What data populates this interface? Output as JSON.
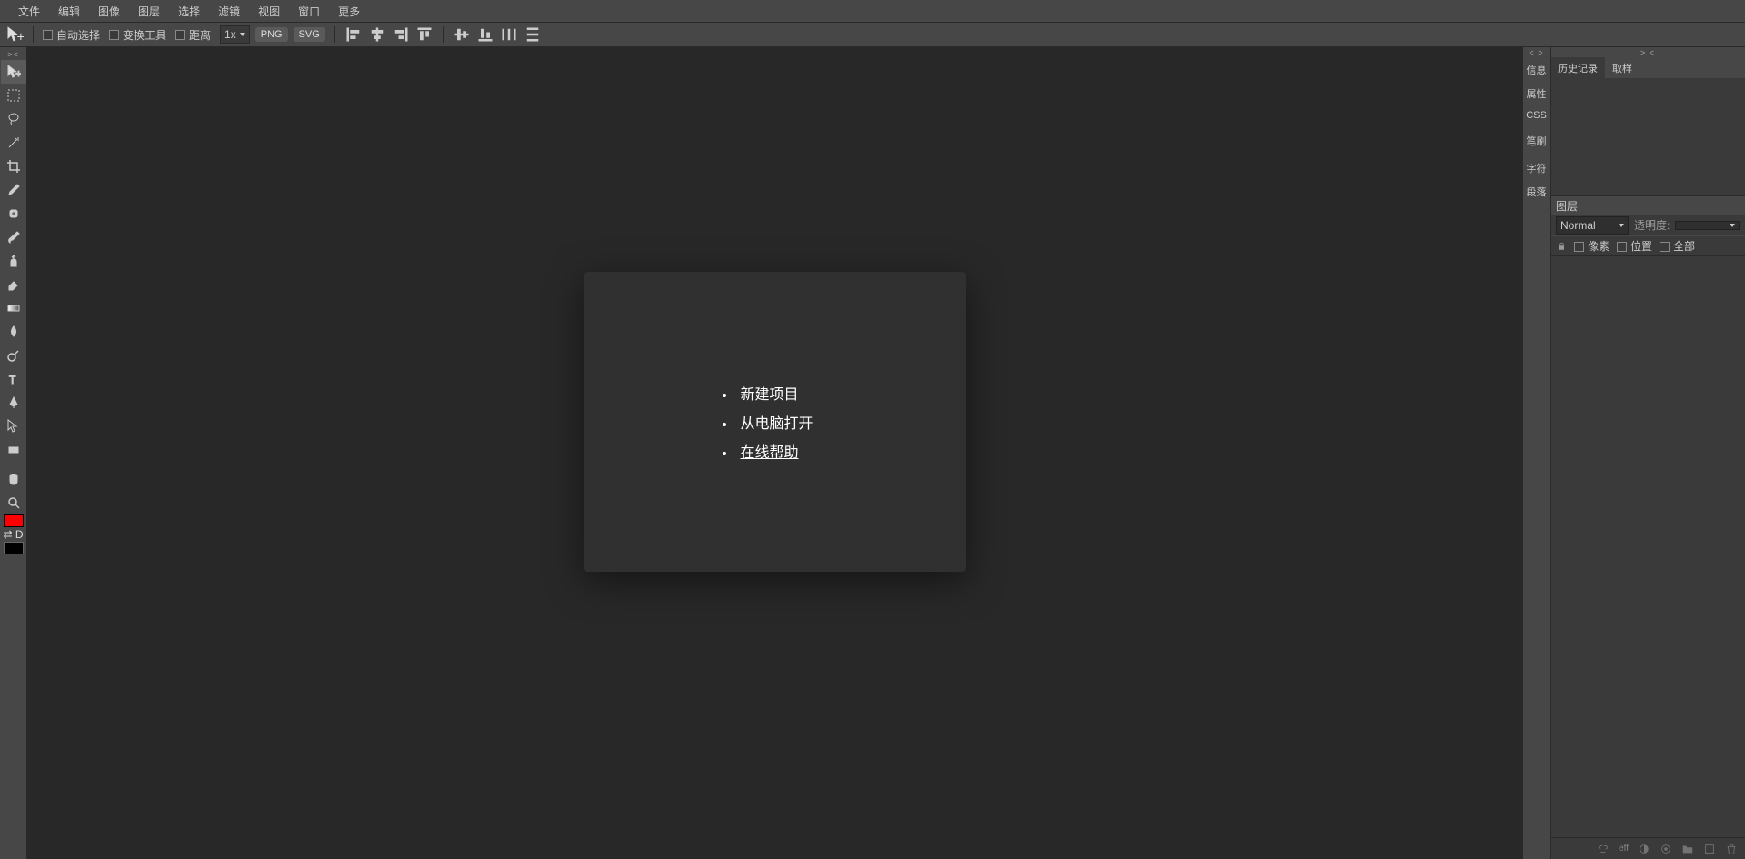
{
  "menu": [
    "文件",
    "编辑",
    "图像",
    "图层",
    "选择",
    "滤镜",
    "视图",
    "窗口",
    "更多"
  ],
  "options": {
    "auto_select": "自动选择",
    "transform": "变换工具",
    "distance": "距离",
    "zoom": "1x",
    "png": "PNG",
    "svg": "SVG"
  },
  "welcome": {
    "new_project": "新建项目",
    "open_from_pc": "从电脑打开",
    "online_help": "在线帮助"
  },
  "rail": [
    "信息",
    "属性",
    "CSS",
    "笔刷",
    "字符",
    "段落"
  ],
  "panels": {
    "history": "历史记录",
    "swatches": "取样",
    "layers": "图层",
    "blend": "Normal",
    "opacity": "透明度:",
    "pixels": "像素",
    "position": "位置",
    "all": "全部",
    "eff": "eff"
  },
  "colors": {
    "fg": "#ff0000",
    "bg": "#000000"
  }
}
